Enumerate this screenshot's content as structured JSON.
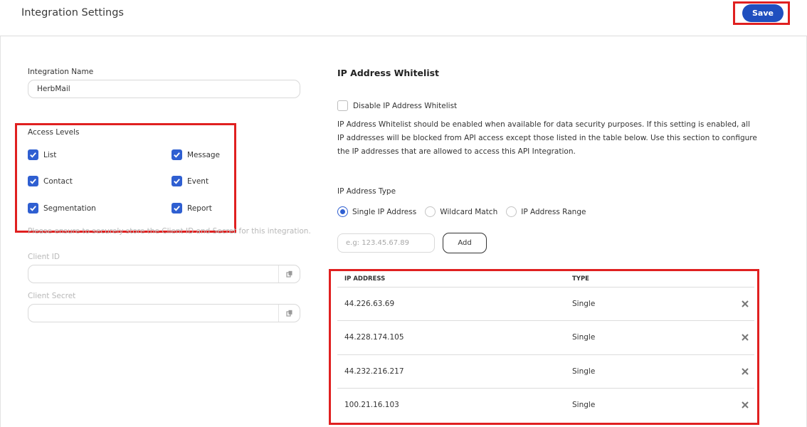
{
  "header": {
    "title": "Integration Settings",
    "save_label": "Save"
  },
  "left": {
    "integration_name_label": "Integration Name",
    "integration_name_value": "HerbMail",
    "access_levels_label": "Access Levels",
    "access_levels": [
      {
        "label": "List",
        "checked": true
      },
      {
        "label": "Message",
        "checked": true
      },
      {
        "label": "Contact",
        "checked": true
      },
      {
        "label": "Event",
        "checked": true
      },
      {
        "label": "Segmentation",
        "checked": true
      },
      {
        "label": "Report",
        "checked": true
      }
    ],
    "secure_note": "Please ensure to securely store the Client ID and Secret for this integration.",
    "client_id_label": "Client ID",
    "client_id_value": "",
    "client_secret_label": "Client Secret",
    "client_secret_value": ""
  },
  "right": {
    "section_title": "IP Address Whitelist",
    "disable_label": "Disable IP Address Whitelist",
    "disable_checked": false,
    "description": "IP Address Whitelist should be enabled when available for data security purposes. If this setting is enabled, all IP addresses will be blocked from API access except those listed in the table below. Use this section to configure the IP addresses that are allowed to access this API Integration.",
    "type_label": "IP Address Type",
    "types": [
      {
        "label": "Single IP Address",
        "selected": true
      },
      {
        "label": "Wildcard Match",
        "selected": false
      },
      {
        "label": "IP Address Range",
        "selected": false
      }
    ],
    "ip_placeholder": "e.g: 123.45.67.89",
    "add_label": "Add",
    "table": {
      "headers": [
        "IP ADDRESS",
        "TYPE"
      ],
      "rows": [
        {
          "ip": "44.226.63.69",
          "type": "Single"
        },
        {
          "ip": "44.228.174.105",
          "type": "Single"
        },
        {
          "ip": "44.232.216.217",
          "type": "Single"
        },
        {
          "ip": "100.21.16.103",
          "type": "Single"
        }
      ]
    }
  },
  "colors": {
    "primary": "#1f4fbf",
    "checkbox": "#2f5fd1",
    "highlight": "#e02020"
  }
}
